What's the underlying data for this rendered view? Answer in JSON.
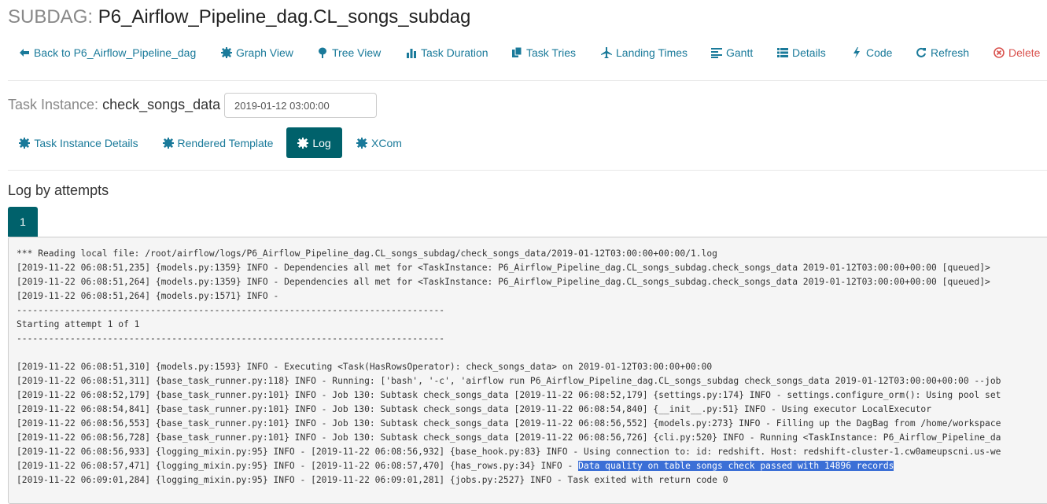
{
  "header": {
    "prefix": "SUBDAG:",
    "dag_id": "P6_Airflow_Pipeline_dag.CL_songs_subdag"
  },
  "nav": [
    {
      "label": "Back to P6_Airflow_Pipeline_dag",
      "icon": "arrow-left-icon"
    },
    {
      "label": "Graph View",
      "icon": "certificate-icon"
    },
    {
      "label": "Tree View",
      "icon": "tree-icon"
    },
    {
      "label": "Task Duration",
      "icon": "bar-chart-icon"
    },
    {
      "label": "Task Tries",
      "icon": "duplicate-icon"
    },
    {
      "label": "Landing Times",
      "icon": "plane-icon"
    },
    {
      "label": "Gantt",
      "icon": "align-left-icon"
    },
    {
      "label": "Details",
      "icon": "list-icon"
    },
    {
      "label": "Code",
      "icon": "flash-icon"
    },
    {
      "label": "Refresh",
      "icon": "refresh-icon"
    },
    {
      "label": "Delete",
      "icon": "remove-circle-icon"
    }
  ],
  "task_instance": {
    "label": "Task Instance:",
    "task_id": "check_songs_data",
    "execution_date": "2019-01-12 03:00:00"
  },
  "tabs": [
    {
      "label": "Task Instance Details",
      "active": false
    },
    {
      "label": "Rendered Template",
      "active": false
    },
    {
      "label": "Log",
      "active": true
    },
    {
      "label": "XCom",
      "active": false
    }
  ],
  "log": {
    "heading": "Log by attempts",
    "attempts": [
      "1"
    ],
    "lines": [
      "*** Reading local file: /root/airflow/logs/P6_Airflow_Pipeline_dag.CL_songs_subdag/check_songs_data/2019-01-12T03:00:00+00:00/1.log",
      "[2019-11-22 06:08:51,235] {models.py:1359} INFO - Dependencies all met for <TaskInstance: P6_Airflow_Pipeline_dag.CL_songs_subdag.check_songs_data 2019-01-12T03:00:00+00:00 [queued]>",
      "[2019-11-22 06:08:51,264] {models.py:1359} INFO - Dependencies all met for <TaskInstance: P6_Airflow_Pipeline_dag.CL_songs_subdag.check_songs_data 2019-01-12T03:00:00+00:00 [queued]>",
      "[2019-11-22 06:08:51,264] {models.py:1571} INFO -",
      "--------------------------------------------------------------------------------",
      "Starting attempt 1 of 1",
      "--------------------------------------------------------------------------------",
      "",
      "[2019-11-22 06:08:51,310] {models.py:1593} INFO - Executing <Task(HasRowsOperator): check_songs_data> on 2019-01-12T03:00:00+00:00",
      "[2019-11-22 06:08:51,311] {base_task_runner.py:118} INFO - Running: ['bash', '-c', 'airflow run P6_Airflow_Pipeline_dag.CL_songs_subdag check_songs_data 2019-01-12T03:00:00+00:00 --job",
      "[2019-11-22 06:08:52,179] {base_task_runner.py:101} INFO - Job 130: Subtask check_songs_data [2019-11-22 06:08:52,179] {settings.py:174} INFO - settings.configure_orm(): Using pool set",
      "[2019-11-22 06:08:54,841] {base_task_runner.py:101} INFO - Job 130: Subtask check_songs_data [2019-11-22 06:08:54,840] {__init__.py:51} INFO - Using executor LocalExecutor",
      "[2019-11-22 06:08:56,553] {base_task_runner.py:101} INFO - Job 130: Subtask check_songs_data [2019-11-22 06:08:56,552] {models.py:273} INFO - Filling up the DagBag from /home/workspace",
      "[2019-11-22 06:08:56,728] {base_task_runner.py:101} INFO - Job 130: Subtask check_songs_data [2019-11-22 06:08:56,726] {cli.py:520} INFO - Running <TaskInstance: P6_Airflow_Pipeline_da",
      "[2019-11-22 06:08:56,933] {logging_mixin.py:95} INFO - [2019-11-22 06:08:56,932] {base_hook.py:83} INFO - Using connection to: id: redshift. Host: redshift-cluster-1.cw0ameupscni.us-we",
      "[2019-11-22 06:08:57,471] {logging_mixin.py:95} INFO - [2019-11-22 06:08:57,470] {has_rows.py:34} INFO - ",
      "[2019-11-22 06:09:01,284] {logging_mixin.py:95} INFO - [2019-11-22 06:09:01,281] {jobs.py:2527} INFO - Task exited with return code 0"
    ],
    "highlight_text": "Data quality on table songs check passed with 14896 records"
  },
  "colors": {
    "link": "#1a7a9a",
    "active_tab": "#00616b",
    "danger": "#d9534f",
    "highlight": "#3b6fd6"
  }
}
